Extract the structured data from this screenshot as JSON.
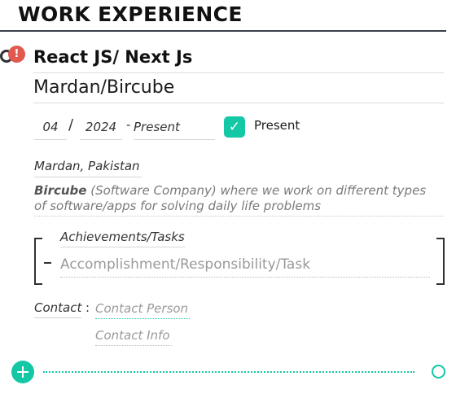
{
  "section": {
    "title": "WORK EXPERIENCE"
  },
  "entry": {
    "alert_glyph": "!",
    "role": "React JS/ Next Js",
    "company": "Mardan/Bircube",
    "start_month": "04",
    "date_separator": "/",
    "start_year": "2024",
    "range_separator": "-",
    "end_date": "Present",
    "present_checkbox": {
      "checked": true,
      "glyph": "✓",
      "label": "Present"
    },
    "location": "Mardan, Pakistan",
    "description": {
      "company_bold": "Bircube",
      "text": " (Software Company) where we work on different types of software/apps for solving daily life problems"
    },
    "achievements": {
      "heading": "Achievements/Tasks",
      "bullet": "-",
      "item_placeholder": "Accomplishment/Responsibility/Task"
    },
    "contact": {
      "label": "Contact",
      "colon": ":",
      "person_placeholder": "Contact Person",
      "info_placeholder": "Contact Info"
    }
  },
  "colors": {
    "accent": "#14c8a6",
    "alert": "#e05a4f",
    "rule": "#3a3f4a"
  },
  "icons": {
    "add": "plus-circle-icon",
    "alert": "exclamation-icon",
    "checkbox": "checkmark-icon",
    "timeline": "timeline-node-icon"
  }
}
